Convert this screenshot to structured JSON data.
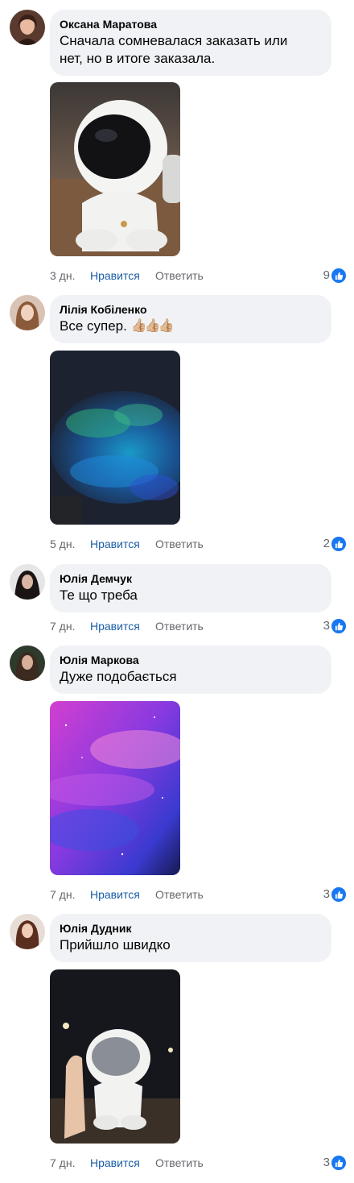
{
  "comments": [
    {
      "author": "Оксана Маратова",
      "text": "Сначала сомневалася заказать или\nнет, но в итоге заказала.",
      "emoji": "",
      "time": "3 дн.",
      "like_label": "Нравится",
      "reply_label": "Ответить",
      "reactions": "9"
    },
    {
      "author": "Лілія Кобіленко",
      "text": "Все супер.",
      "emoji": "👍🏼👍🏼👍🏼",
      "time": "5 дн.",
      "like_label": "Нравится",
      "reply_label": "Ответить",
      "reactions": "2"
    },
    {
      "author": "Юлія Демчук",
      "text": "Те що треба",
      "emoji": "",
      "time": "7 дн.",
      "like_label": "Нравится",
      "reply_label": "Ответить",
      "reactions": "3"
    },
    {
      "author": "Юлія Маркова",
      "text": "Дуже подобається",
      "emoji": "",
      "time": "7 дн.",
      "like_label": "Нравится",
      "reply_label": "Ответить",
      "reactions": "3"
    },
    {
      "author": "Юлія Дудник",
      "text": "Прийшло швидко",
      "emoji": "",
      "time": "7 дн.",
      "like_label": "Нравится",
      "reply_label": "Ответить",
      "reactions": "3"
    }
  ],
  "colors": {
    "bubble": "#f0f2f5",
    "like_link": "#1b5da8",
    "muted": "#65676b",
    "reaction_blue": "#1877f2"
  }
}
